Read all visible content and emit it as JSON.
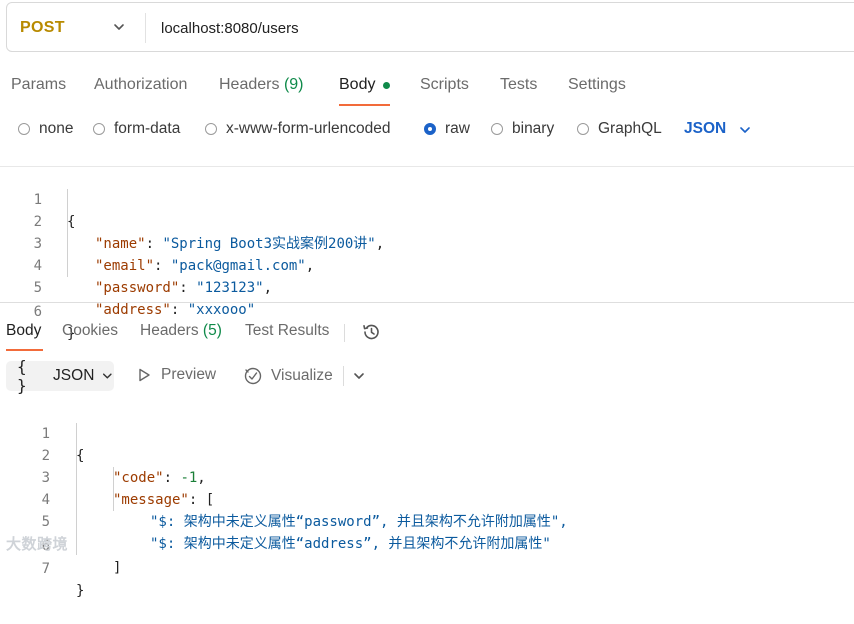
{
  "request": {
    "method": "POST",
    "url": "localhost:8080/users"
  },
  "request_tabs": [
    {
      "label": "Params"
    },
    {
      "label": "Authorization"
    },
    {
      "label": "Headers",
      "count": "(9)"
    },
    {
      "label": "Body",
      "active": true
    },
    {
      "label": "Scripts"
    },
    {
      "label": "Tests"
    },
    {
      "label": "Settings"
    }
  ],
  "body_types": {
    "options": [
      "none",
      "form-data",
      "x-www-form-urlencoded",
      "raw",
      "binary",
      "GraphQL"
    ],
    "selected": "raw",
    "format": "JSON"
  },
  "request_body": {
    "line_numbers": [
      "1",
      "2",
      "3",
      "4",
      "5",
      "6"
    ],
    "open": "{",
    "close": "}",
    "fields": [
      {
        "key": "\"name\"",
        "value": "\"Spring Boot3实战案例200讲\"",
        "end": ","
      },
      {
        "key": "\"email\"",
        "value": "\"pack@gmail.com\"",
        "end": ","
      },
      {
        "key": "\"password\"",
        "value": "\"123123\"",
        "end": ","
      },
      {
        "key": "\"address\"",
        "value": "\"xxxooo\"",
        "end": ""
      }
    ]
  },
  "response_tabs": [
    {
      "label": "Body",
      "active": true
    },
    {
      "label": "Cookies"
    },
    {
      "label": "Headers",
      "count": "(5)"
    },
    {
      "label": "Test Results"
    }
  ],
  "response_toolbar": {
    "format": "JSON",
    "preview": "Preview",
    "visualize": "Visualize"
  },
  "response_body": {
    "line_numbers": [
      "1",
      "2",
      "3",
      "4",
      "5",
      "6",
      "7"
    ],
    "open": "{",
    "code_key": "\"code\"",
    "code_value": "-1",
    "message_key": "\"message\"",
    "message_open": "[",
    "messages": [
      "\"$: 架构中未定义属性“password”, 并且架构不允许附加属性\",",
      "\"$: 架构中未定义属性“address”, 并且架构不允许附加属性\""
    ],
    "message_close": "]",
    "close": "}"
  },
  "watermark": "大数跨境",
  "colors": {
    "method": "#b88a00",
    "accent_underline": "#f26b3a",
    "count_green": "#0f8a4a",
    "selected_blue": "#1b62c8"
  }
}
